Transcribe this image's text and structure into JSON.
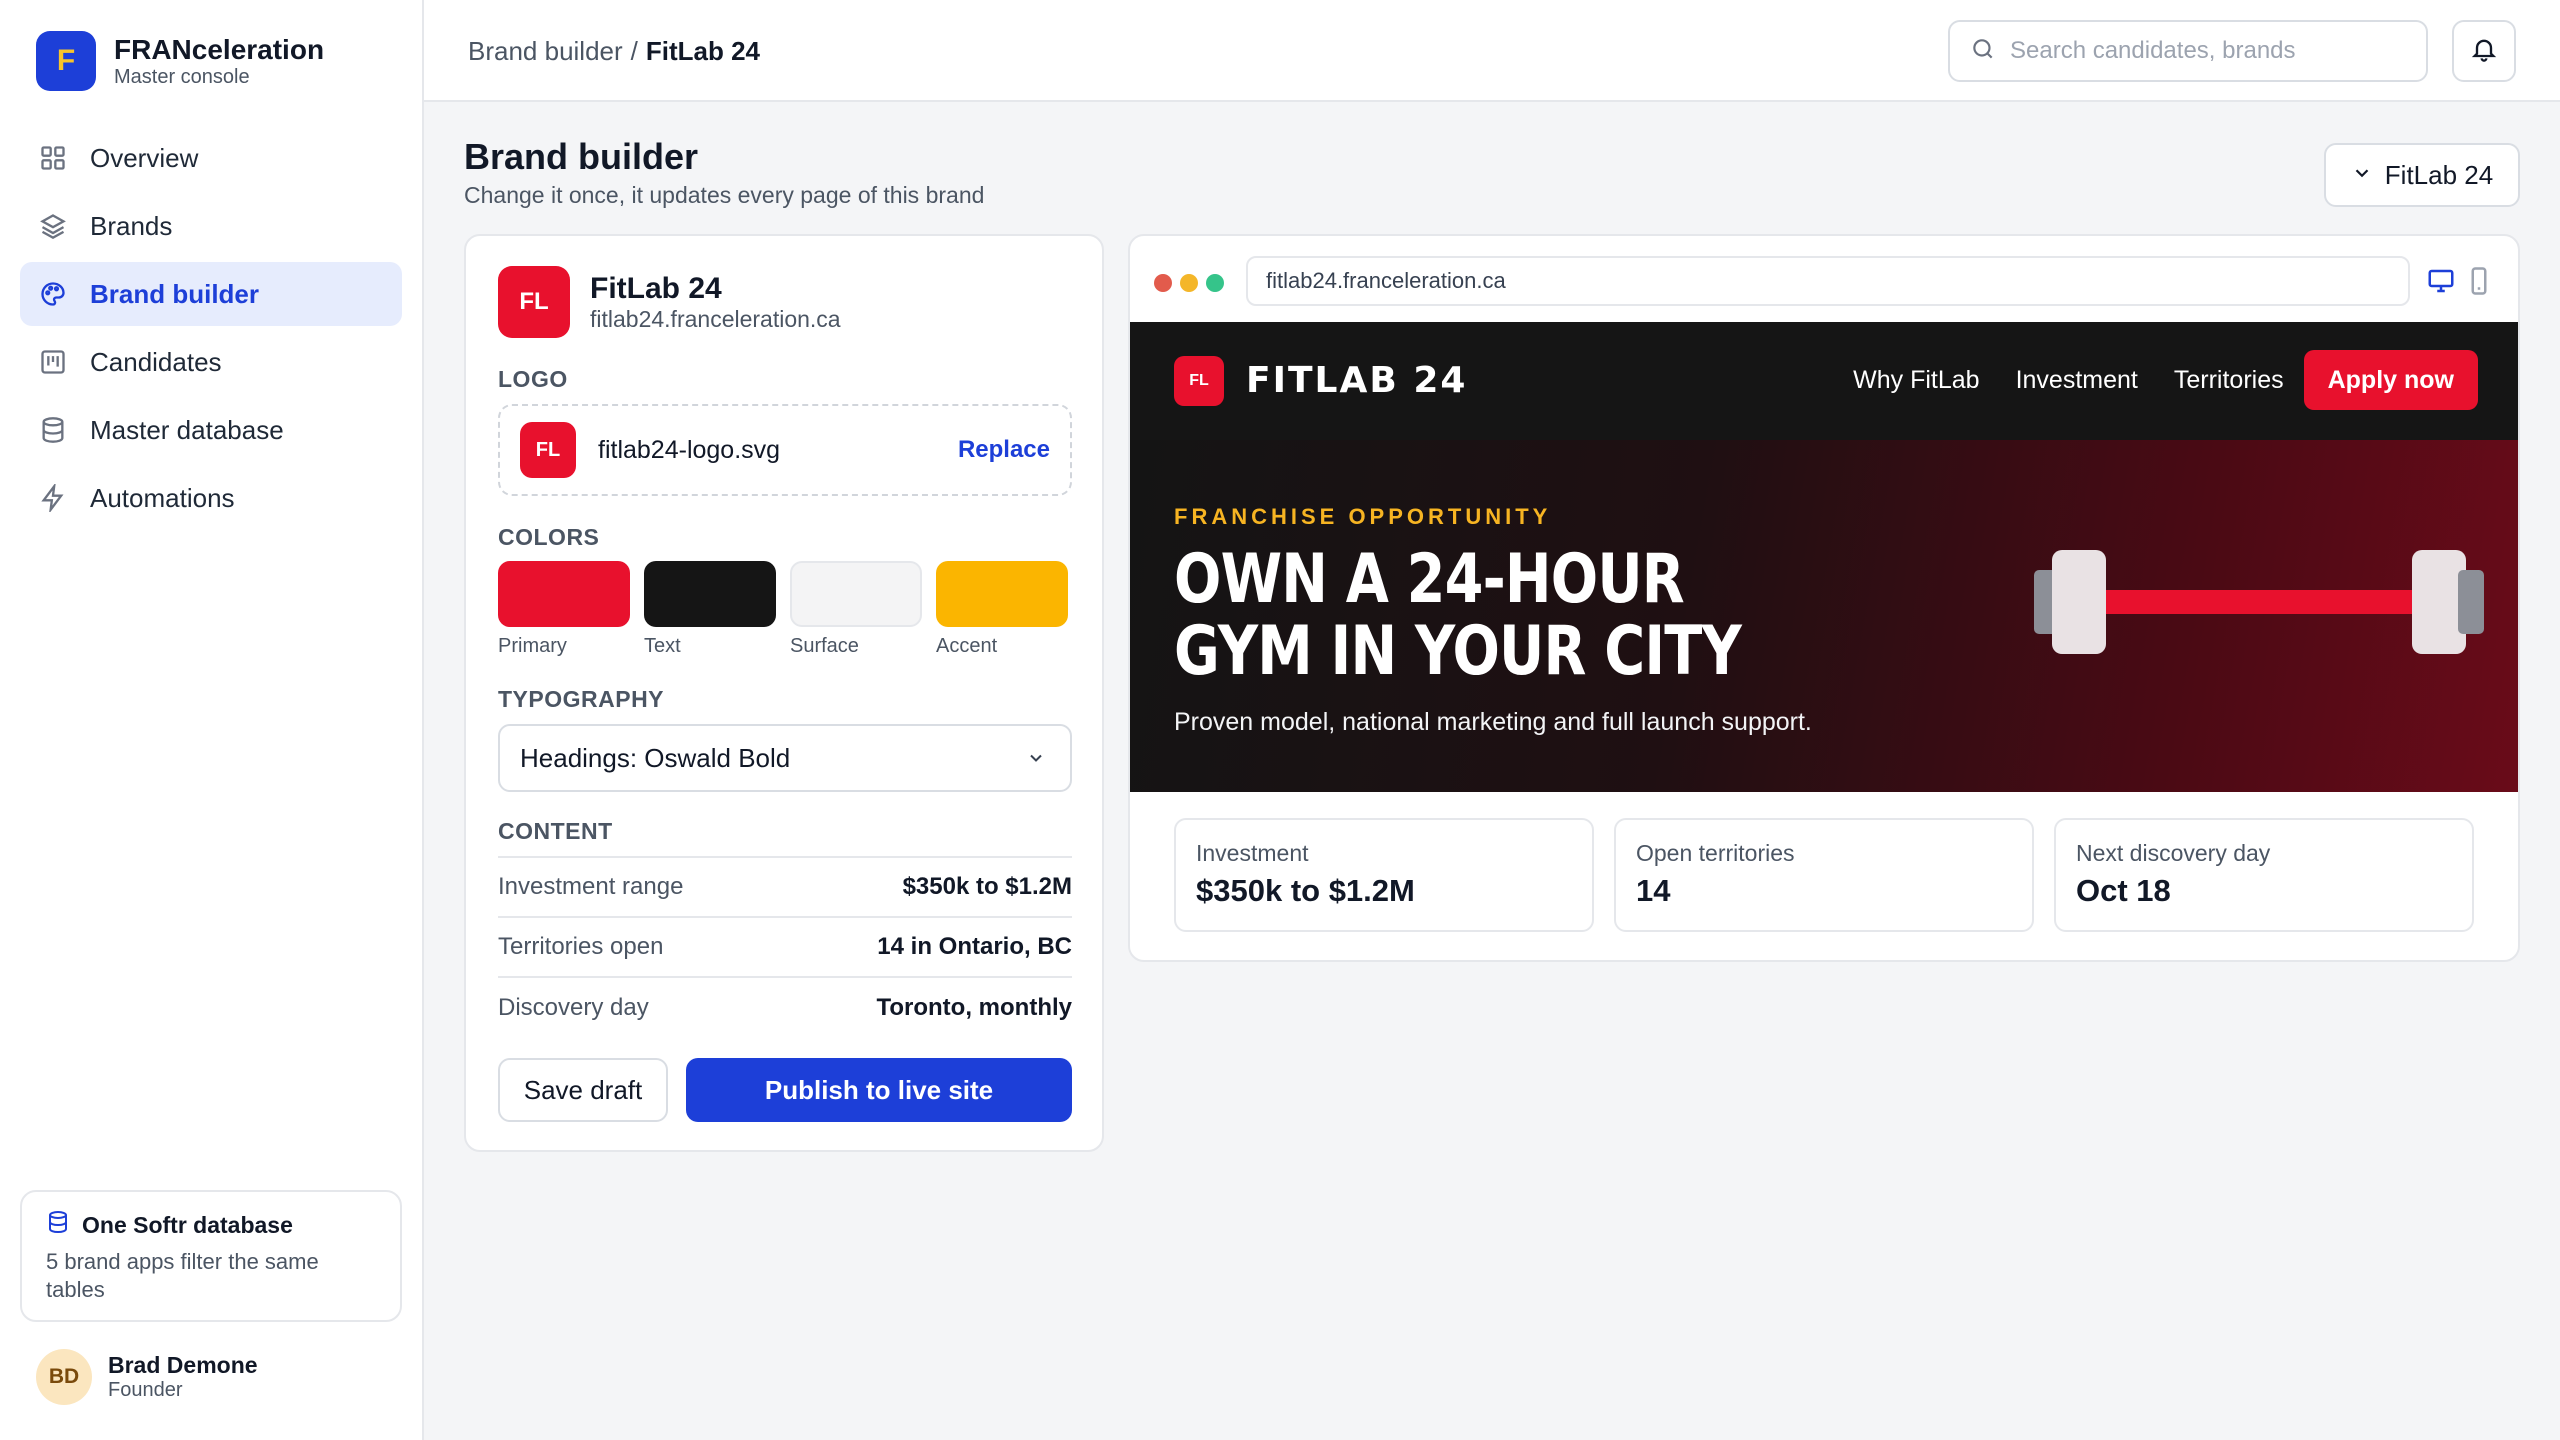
{
  "app": {
    "logo_letter": "F",
    "name": "FRANceleration",
    "subtitle": "Master console"
  },
  "sidebar": {
    "items": [
      {
        "label": "Overview",
        "icon": "grid-icon",
        "active": false
      },
      {
        "label": "Brands",
        "icon": "layers-icon",
        "active": false
      },
      {
        "label": "Brand builder",
        "icon": "palette-icon",
        "active": true
      },
      {
        "label": "Candidates",
        "icon": "kanban-icon",
        "active": false
      },
      {
        "label": "Master database",
        "icon": "database-icon",
        "active": false
      },
      {
        "label": "Automations",
        "icon": "bolt-icon",
        "active": false
      }
    ],
    "db_card": {
      "title": "One Softr database",
      "desc": "5 brand apps filter the same tables"
    },
    "user": {
      "initials": "BD",
      "name": "Brad Demone",
      "role": "Founder"
    }
  },
  "topbar": {
    "breadcrumb": {
      "parent": "Brand builder",
      "sep": "/",
      "current": "FitLab 24"
    },
    "search_placeholder": "Search candidates, brands"
  },
  "page": {
    "title": "Brand builder",
    "subtitle": "Change it once, it updates every page of this brand",
    "brand_select": "FitLab 24"
  },
  "editor": {
    "badge": "FL",
    "name": "FitLab 24",
    "domain": "fitlab24.franceleration.ca",
    "logo_label": "LOGO",
    "logo_file": "fitlab24-logo.svg",
    "replace_label": "Replace",
    "colors_label": "COLORS",
    "colors": [
      {
        "label": "Primary",
        "hex": "#e8112d"
      },
      {
        "label": "Text",
        "hex": "#151515"
      },
      {
        "label": "Surface",
        "hex": "#f4f4f5"
      },
      {
        "label": "Accent",
        "hex": "#fbb500"
      }
    ],
    "typography_label": "TYPOGRAPHY",
    "typography_value": "Headings: Oswald Bold",
    "content_label": "CONTENT",
    "content": [
      {
        "key": "Investment range",
        "value": "$350k to $1.2M"
      },
      {
        "key": "Territories open",
        "value": "14 in Ontario, BC"
      },
      {
        "key": "Discovery day",
        "value": "Toronto, monthly"
      }
    ],
    "save_label": "Save draft",
    "publish_label": "Publish to live site"
  },
  "preview": {
    "url": "fitlab24.franceleration.ca",
    "site": {
      "badge": "FL",
      "brand": "FITLAB 24",
      "links": [
        "Why FitLab",
        "Investment",
        "Territories"
      ],
      "apply_label": "Apply now",
      "eyebrow": "FRANCHISE OPPORTUNITY",
      "headline": "OWN A 24-HOUR GYM IN YOUR CITY",
      "subline": "Proven model, national marketing and full launch support."
    },
    "stats": [
      {
        "label": "Investment",
        "value": "$350k to $1.2M"
      },
      {
        "label": "Open territories",
        "value": "14"
      },
      {
        "label": "Next discovery day",
        "value": "Oct 18"
      }
    ]
  }
}
